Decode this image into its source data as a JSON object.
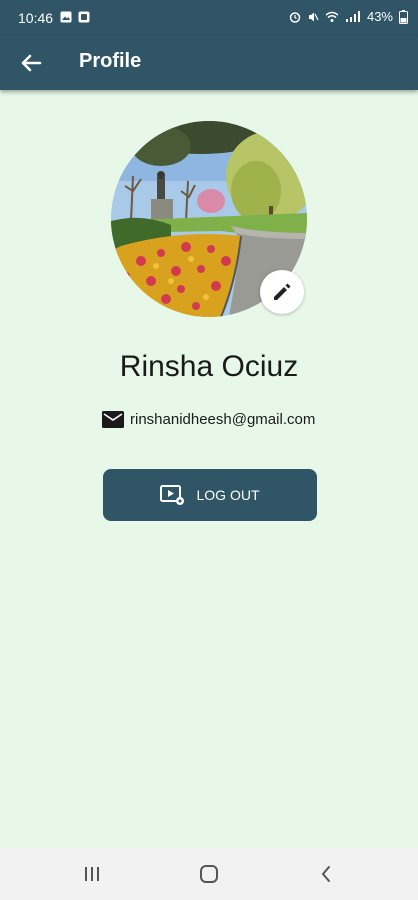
{
  "status": {
    "time": "10:46",
    "battery": "43%"
  },
  "appbar": {
    "title": "Profile"
  },
  "profile": {
    "name": "Rinsha Ociuz",
    "email": "rinshanidheesh@gmail.com"
  },
  "actions": {
    "logout_label": "LOG OUT"
  },
  "icons": {
    "back": "arrow-left-icon",
    "edit": "pencil-icon",
    "mail": "mail-icon",
    "logout": "video-settings-icon"
  },
  "colors": {
    "primary": "#2f5566",
    "background": "#e8f8e8"
  }
}
